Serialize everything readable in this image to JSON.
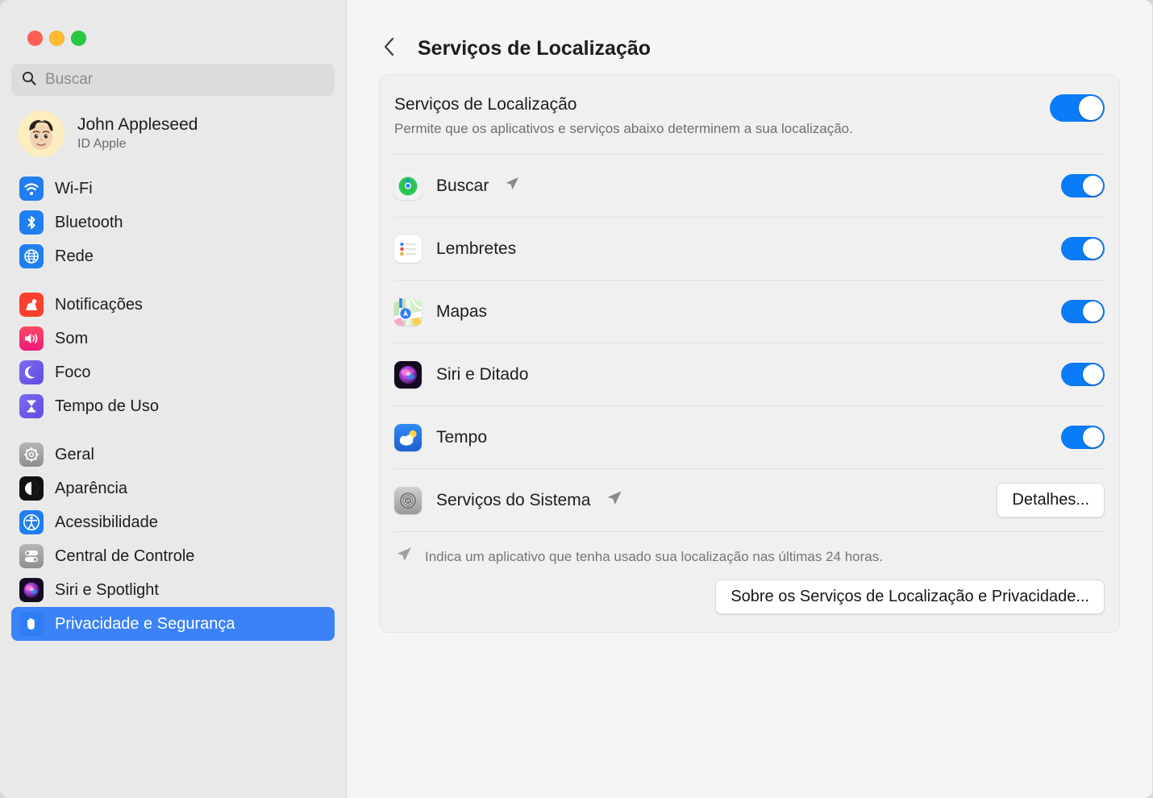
{
  "window": {
    "traffic_lights": [
      {
        "name": "close",
        "color": "#ff5f57"
      },
      {
        "name": "minimize",
        "color": "#febc2e"
      },
      {
        "name": "zoom",
        "color": "#28c840"
      }
    ]
  },
  "sidebar": {
    "search": {
      "placeholder": "Buscar",
      "value": "",
      "icon": "search-icon"
    },
    "account": {
      "name": "John Appleseed",
      "subtitle": "ID Apple",
      "avatar": "memoji-avatar"
    },
    "groups": [
      {
        "items": [
          {
            "label": "Wi-Fi",
            "icon": "wifi-icon",
            "selected": false
          },
          {
            "label": "Bluetooth",
            "icon": "bluetooth-icon",
            "selected": false
          },
          {
            "label": "Rede",
            "icon": "network-globe-icon",
            "selected": false
          }
        ]
      },
      {
        "items": [
          {
            "label": "Notificações",
            "icon": "notifications-bell-icon",
            "selected": false
          },
          {
            "label": "Som",
            "icon": "sound-speaker-icon",
            "selected": false
          },
          {
            "label": "Foco",
            "icon": "focus-moon-icon",
            "selected": false
          },
          {
            "label": "Tempo de Uso",
            "icon": "screen-time-hourglass-icon",
            "selected": false
          }
        ]
      },
      {
        "items": [
          {
            "label": "Geral",
            "icon": "general-gear-icon",
            "selected": false
          },
          {
            "label": "Aparência",
            "icon": "appearance-contrast-icon",
            "selected": false
          },
          {
            "label": "Acessibilidade",
            "icon": "accessibility-icon",
            "selected": false
          },
          {
            "label": "Central de Controle",
            "icon": "control-center-icon",
            "selected": false
          },
          {
            "label": "Siri e Spotlight",
            "icon": "siri-orb-icon",
            "selected": false
          },
          {
            "label": "Privacidade e Segurança",
            "icon": "privacy-hand-icon",
            "selected": true
          }
        ]
      }
    ]
  },
  "main": {
    "back_button": "chevron-left-icon",
    "title": "Serviços de Localização",
    "master": {
      "title": "Serviços de Localização",
      "subtitle": "Permite que os aplicativos e serviços abaixo determinem a sua localização.",
      "toggle_on": true
    },
    "apps": [
      {
        "name": "Buscar",
        "icon": "find-my-icon",
        "recent_location": true,
        "toggle_on": true
      },
      {
        "name": "Lembretes",
        "icon": "reminders-icon",
        "recent_location": false,
        "toggle_on": true
      },
      {
        "name": "Mapas",
        "icon": "maps-icon",
        "recent_location": false,
        "toggle_on": true
      },
      {
        "name": "Siri e Ditado",
        "icon": "siri-orb-icon",
        "recent_location": false,
        "toggle_on": true
      },
      {
        "name": "Tempo",
        "icon": "weather-icon",
        "recent_location": false,
        "toggle_on": true
      }
    ],
    "system_services": {
      "name": "Serviços do Sistema",
      "icon": "system-services-gear-icon",
      "recent_location": true,
      "details_button": "Detalhes..."
    },
    "footnote": {
      "icon": "location-arrow-icon",
      "text": "Indica um aplicativo que tenha usado sua localização nas últimas 24 horas."
    },
    "about_button": "Sobre os Serviços de Localização e Privacidade..."
  },
  "colors": {
    "accent_blue": "#3b82f7",
    "toggle_on": "#0a7cf8",
    "sidebar_bg": "#e9e9e9",
    "main_bg": "#f5f5f5",
    "card_bg": "#f0f0f0"
  }
}
